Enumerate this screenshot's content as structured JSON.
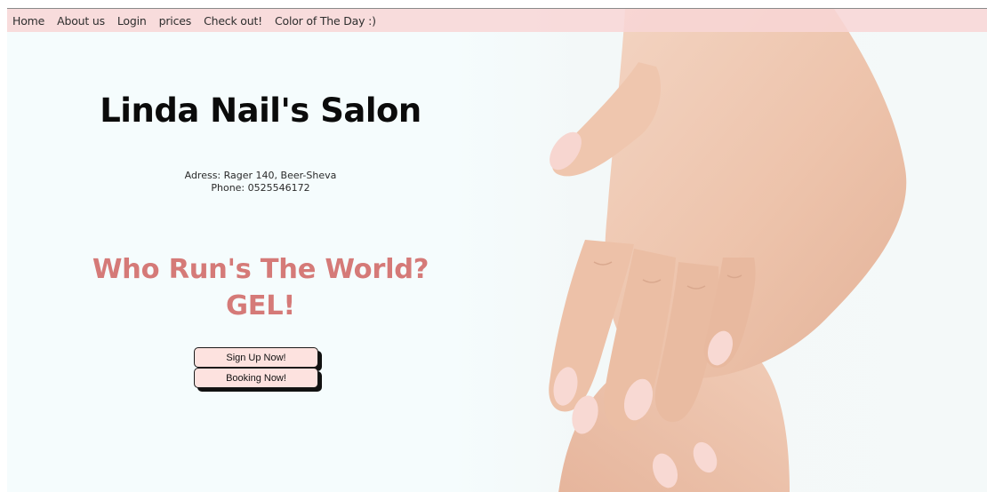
{
  "nav": {
    "items": [
      {
        "label": "Home"
      },
      {
        "label": "About us"
      },
      {
        "label": "Login"
      },
      {
        "label": "prices"
      },
      {
        "label": "Check out!"
      },
      {
        "label": "Color of The Day :)"
      }
    ]
  },
  "hero": {
    "title": "Linda Nail's Salon",
    "address": "Adress: Rager 140, Beer-Sheva",
    "phone": "Phone: 0525546172",
    "slogan_line1": "Who Run's The World?",
    "slogan_line2": "GEL!",
    "signup_label": "Sign Up Now!",
    "booking_label": "Booking Now!"
  },
  "colors": {
    "nav_bg": "#f8d6d6",
    "page_bg": "#f5fcfd",
    "slogan": "#d57a78",
    "button_bg": "#fde2df",
    "skin": "#efc7b1",
    "nail": "#f6cfc9"
  }
}
